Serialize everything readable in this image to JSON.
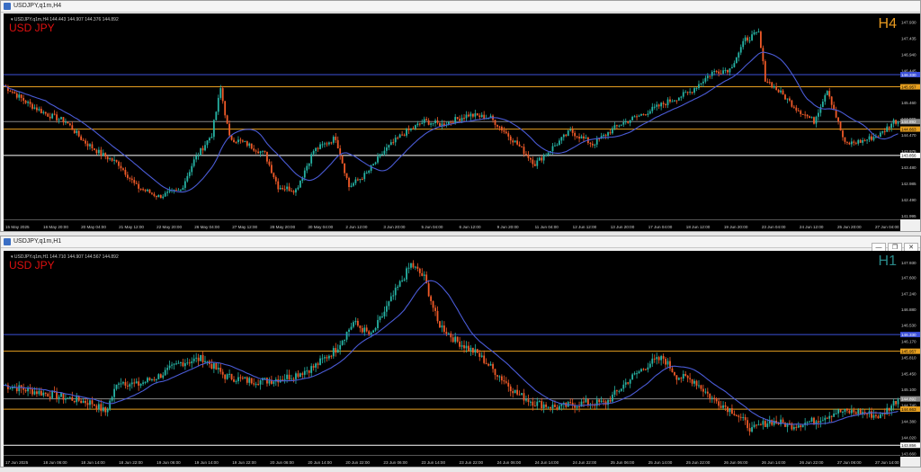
{
  "top_window": {
    "title": "USDJPY,q1m,H4",
    "chart_header": "USDJPY.q1m,H4  144.443 144.907 144.376 144.892",
    "symbol_label": "USD JPY",
    "timeframe_label": "H4",
    "price_ticks": [
      "147.930",
      "147.435",
      "146.940",
      "146.445",
      "145.950",
      "145.460",
      "144.965",
      "144.470",
      "143.975",
      "143.480",
      "142.985",
      "142.490",
      "141.995"
    ],
    "hlines": [
      {
        "price": 146.33,
        "label": "146.330",
        "color": "#3b4fd8"
      },
      {
        "price": 145.957,
        "label": "145.957",
        "color": "#e8a020"
      },
      {
        "price": 144.892,
        "label": "144.892",
        "color": "#888888"
      },
      {
        "price": 144.663,
        "label": "144.663",
        "color": "#e8a020"
      },
      {
        "price": 143.856,
        "label": "143.856",
        "color": "#ffffff"
      }
    ],
    "time_ticks": [
      "15 May 2025",
      "16 May 20:00",
      "20 May 04:00",
      "21 May 12:00",
      "22 May 20:00",
      "26 May 04:00",
      "27 May 12:00",
      "28 May 20:00",
      "30 May 04:00",
      "2 Jun 12:00",
      "3 Jun 20:00",
      "5 Jun 04:00",
      "6 Jun 12:00",
      "9 Jun 20:00",
      "11 Jun 04:00",
      "12 Jun 12:00",
      "13 Jun 20:00",
      "17 Jun 04:00",
      "18 Jun 12:00",
      "19 Jun 20:00",
      "23 Jun 04:00",
      "24 Jun 12:00",
      "25 Jun 20:00",
      "27 Jun 04:00"
    ],
    "y_range": [
      141.9,
      148.2
    ],
    "anchors": [
      [
        0,
        146.0
      ],
      [
        6,
        145.7
      ],
      [
        12,
        145.4
      ],
      [
        20,
        145.1
      ],
      [
        28,
        144.9
      ],
      [
        36,
        144.3
      ],
      [
        44,
        143.9
      ],
      [
        52,
        143.6
      ],
      [
        60,
        142.9
      ],
      [
        70,
        142.6
      ],
      [
        80,
        142.8
      ],
      [
        86,
        143.7
      ],
      [
        94,
        144.5
      ],
      [
        98,
        145.9
      ],
      [
        102,
        144.4
      ],
      [
        110,
        144.2
      ],
      [
        118,
        143.9
      ],
      [
        124,
        142.9
      ],
      [
        132,
        142.8
      ],
      [
        140,
        144.0
      ],
      [
        150,
        144.4
      ],
      [
        156,
        142.9
      ],
      [
        164,
        143.3
      ],
      [
        172,
        144.0
      ],
      [
        180,
        144.5
      ],
      [
        190,
        144.9
      ],
      [
        198,
        144.8
      ],
      [
        210,
        145.1
      ],
      [
        220,
        145.0
      ],
      [
        232,
        144.2
      ],
      [
        240,
        143.6
      ],
      [
        248,
        144.1
      ],
      [
        256,
        144.6
      ],
      [
        266,
        144.2
      ],
      [
        278,
        144.8
      ],
      [
        288,
        145.1
      ],
      [
        300,
        145.5
      ],
      [
        310,
        145.8
      ],
      [
        320,
        146.4
      ],
      [
        328,
        146.5
      ],
      [
        335,
        147.4
      ],
      [
        341,
        147.6
      ],
      [
        344,
        146.2
      ],
      [
        352,
        145.7
      ],
      [
        358,
        145.3
      ],
      [
        366,
        144.9
      ],
      [
        372,
        145.9
      ],
      [
        380,
        144.2
      ],
      [
        388,
        144.3
      ],
      [
        396,
        144.5
      ],
      [
        402,
        144.9
      ]
    ]
  },
  "bottom_window": {
    "title": "USDJPY,q1m,H1",
    "chart_header": "USDJPY.q1m,H1  144.710 144.907 144.567 144.892",
    "symbol_label": "USD JPY",
    "timeframe_label": "H1",
    "price_ticks": [
      "147.930",
      "147.600",
      "147.240",
      "146.880",
      "146.530",
      "146.170",
      "145.810",
      "145.450",
      "145.100",
      "144.740",
      "144.380",
      "144.020",
      "143.660"
    ],
    "hlines": [
      {
        "price": 146.33,
        "label": "146.330",
        "color": "#3b4fd8"
      },
      {
        "price": 145.957,
        "label": "145.957",
        "color": "#e8a020"
      },
      {
        "price": 144.892,
        "label": "144.892",
        "color": "#888888"
      },
      {
        "price": 144.663,
        "label": "144.663",
        "color": "#e8a020"
      },
      {
        "price": 143.856,
        "label": "143.856",
        "color": "#ffffff"
      }
    ],
    "time_ticks": [
      "17 Jun 2025",
      "18 Jun 06:00",
      "18 Jun 14:00",
      "18 Jun 22:00",
      "19 Jun 06:00",
      "19 Jun 14:00",
      "19 Jun 22:00",
      "20 Jun 06:00",
      "20 Jun 14:00",
      "20 Jun 22:00",
      "23 Jun 06:00",
      "23 Jun 14:00",
      "23 Jun 22:00",
      "24 Jun 06:00",
      "24 Jun 14:00",
      "24 Jun 22:00",
      "25 Jun 06:00",
      "25 Jun 14:00",
      "25 Jun 22:00",
      "26 Jun 06:00",
      "26 Jun 14:00",
      "26 Jun 22:00",
      "27 Jun 06:00",
      "27 Jun 14:00"
    ],
    "y_range": [
      143.6,
      148.2
    ],
    "anchors": [
      [
        0,
        145.2
      ],
      [
        10,
        145.1
      ],
      [
        20,
        145.0
      ],
      [
        30,
        144.9
      ],
      [
        40,
        144.8
      ],
      [
        46,
        144.6
      ],
      [
        52,
        145.3
      ],
      [
        60,
        145.2
      ],
      [
        70,
        145.4
      ],
      [
        80,
        145.7
      ],
      [
        90,
        145.8
      ],
      [
        100,
        145.4
      ],
      [
        110,
        145.3
      ],
      [
        120,
        145.3
      ],
      [
        130,
        145.4
      ],
      [
        140,
        145.6
      ],
      [
        150,
        146.0
      ],
      [
        158,
        146.6
      ],
      [
        166,
        146.3
      ],
      [
        176,
        147.2
      ],
      [
        184,
        147.9
      ],
      [
        190,
        147.6
      ],
      [
        196,
        146.6
      ],
      [
        204,
        146.2
      ],
      [
        214,
        145.9
      ],
      [
        224,
        145.4
      ],
      [
        232,
        145.0
      ],
      [
        240,
        144.8
      ],
      [
        250,
        144.7
      ],
      [
        262,
        144.8
      ],
      [
        272,
        144.8
      ],
      [
        282,
        145.3
      ],
      [
        292,
        145.7
      ],
      [
        298,
        145.8
      ],
      [
        304,
        145.4
      ],
      [
        312,
        145.3
      ],
      [
        320,
        144.9
      ],
      [
        330,
        144.6
      ],
      [
        338,
        144.2
      ],
      [
        346,
        144.4
      ],
      [
        356,
        144.3
      ],
      [
        366,
        144.4
      ],
      [
        376,
        144.6
      ],
      [
        386,
        144.6
      ],
      [
        396,
        144.5
      ],
      [
        404,
        144.9
      ]
    ]
  },
  "colors": {
    "bull": "#26b3a4",
    "bear": "#f05a28",
    "ma": "#4a5bd6",
    "symbol": "#e01010",
    "tf_top": "#e89a20",
    "tf_bottom": "#2a8a8a"
  },
  "icons": {
    "minimize": "minimize-icon",
    "restore": "restore-icon",
    "close": "close-icon"
  }
}
